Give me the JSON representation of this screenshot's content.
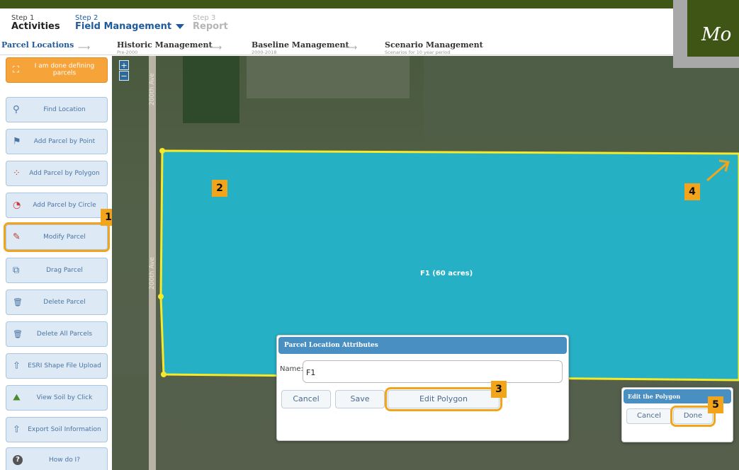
{
  "steps": [
    {
      "num": "Step 1",
      "label": "Activities"
    },
    {
      "num": "Step 2",
      "label": "Field Management"
    },
    {
      "num": "Step 3",
      "label": "Report"
    }
  ],
  "subtabs": [
    {
      "label": "Parcel Locations",
      "sub": ""
    },
    {
      "label": "Historic Management",
      "sub": "Pre-2000"
    },
    {
      "label": "Baseline Management",
      "sub": "2000-2018"
    },
    {
      "label": "Scenario Management",
      "sub": "Scenarios for 10 year period"
    }
  ],
  "title_box": {
    "text": "Mo"
  },
  "sidebar": {
    "tools": [
      {
        "label": "I am done defining parcels",
        "icon": "parcel-done-icon",
        "glyph": "⛶"
      },
      {
        "label": "Find Location",
        "icon": "binoculars-icon",
        "glyph": "⚲"
      },
      {
        "label": "Add Parcel by Point",
        "icon": "flag-icon",
        "glyph": "⚑"
      },
      {
        "label": "Add Parcel by Polygon",
        "icon": "polygon-icon",
        "glyph": "⁘"
      },
      {
        "label": "Add Parcel by Circle",
        "icon": "circle-icon",
        "glyph": "◔"
      },
      {
        "label": "Modify Parcel",
        "icon": "pencil-icon",
        "glyph": "✎"
      },
      {
        "label": "Drag Parcel",
        "icon": "drag-icon",
        "glyph": "⧉"
      },
      {
        "label": "Delete Parcel",
        "icon": "trash-icon",
        "glyph": "🗑"
      },
      {
        "label": "Delete All Parcels",
        "icon": "trash-all-icon",
        "glyph": "🗑"
      },
      {
        "label": "ESRI Shape File Upload",
        "icon": "upload-icon",
        "glyph": "⇧"
      },
      {
        "label": "View Soil by Click",
        "icon": "soil-icon",
        "glyph": "⛰"
      },
      {
        "label": "Export Soil Information",
        "icon": "export-icon",
        "glyph": "⇧"
      },
      {
        "label": "How do I?",
        "icon": "help-icon",
        "glyph": "?"
      }
    ]
  },
  "map": {
    "road_label": "200th Ave",
    "zoom_in": "+",
    "zoom_out": "−",
    "parcel_label": "F1 (60 acres)"
  },
  "badges": [
    "1",
    "2",
    "3",
    "4",
    "5"
  ],
  "attributes_dialog": {
    "title": "Parcel Location Attributes",
    "name_label": "Name:",
    "name_value": "F1",
    "cancel_label": "Cancel",
    "save_label": "Save",
    "edit_label": "Edit Polygon"
  },
  "edit_dialog": {
    "title": "Edit the Polygon",
    "cancel_label": "Cancel",
    "done_label": "Done"
  },
  "colors": {
    "accent": "#f2a51b",
    "parcel_fill": "#23b7cf",
    "parcel_border": "#f5e92a",
    "brand_dark": "#3e5515"
  }
}
